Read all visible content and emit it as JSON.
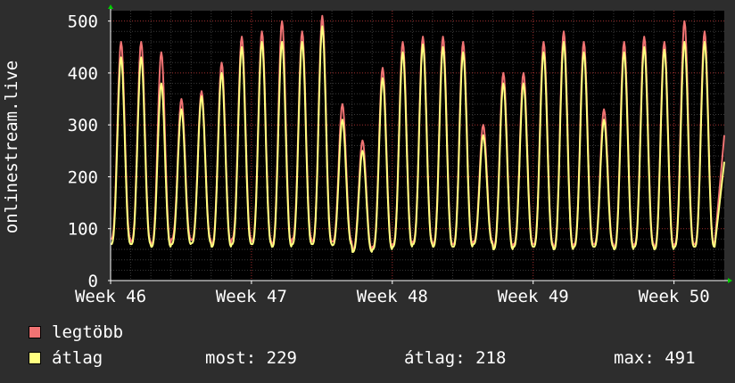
{
  "chart_data": {
    "type": "line",
    "ylabel": "onlinestream.live",
    "xlabel": "",
    "title": "",
    "x_tick_labels": [
      "Week 46",
      "Week 47",
      "Week 48",
      "Week 49",
      "Week 50"
    ],
    "y_ticks": [
      0,
      100,
      200,
      300,
      400,
      500
    ],
    "ylim": [
      0,
      520
    ],
    "grid": true,
    "legend_placement": "bottom-left",
    "x_range_days": [
      0,
      30.5
    ],
    "series": [
      {
        "name": "legtöbb",
        "color": "#f07373",
        "daily_peaks": [
          460,
          460,
          440,
          350,
          365,
          420,
          470,
          480,
          500,
          480,
          510,
          340,
          270,
          410,
          460,
          470,
          470,
          460,
          300,
          400,
          400,
          460,
          480,
          460,
          330,
          460,
          470,
          460,
          500,
          480
        ],
        "daily_troughs": [
          80,
          75,
          70,
          80,
          78,
          70,
          80,
          75,
          70,
          80,
          75,
          75,
          60,
          65,
          70,
          75,
          70,
          70,
          75,
          65,
          70,
          70,
          65,
          70,
          70,
          65,
          70,
          65,
          70,
          70
        ],
        "last_value": 280
      },
      {
        "name": "átlag",
        "color": "#ffff80",
        "daily_peaks": [
          430,
          430,
          380,
          330,
          355,
          400,
          450,
          460,
          460,
          460,
          490,
          310,
          250,
          390,
          440,
          455,
          450,
          440,
          280,
          380,
          380,
          440,
          460,
          440,
          310,
          440,
          450,
          445,
          460,
          460
        ],
        "daily_troughs": [
          70,
          70,
          65,
          70,
          72,
          65,
          70,
          70,
          65,
          70,
          70,
          68,
          55,
          60,
          65,
          70,
          65,
          65,
          70,
          60,
          65,
          65,
          60,
          65,
          65,
          60,
          65,
          60,
          65,
          65
        ],
        "last_value": 229
      }
    ],
    "stats": {
      "current_label": "most:",
      "current_value": "229",
      "average_label": "átlag:",
      "average_value": "218",
      "max_label": "max:",
      "max_value": "491"
    }
  },
  "colors": {
    "background": "#2d2d2d",
    "plot_background": "#000000",
    "grid_minor": "#3a3a3a",
    "grid_major": "#a03030",
    "axis": "#ffffff",
    "arrow": "#00cc00"
  }
}
